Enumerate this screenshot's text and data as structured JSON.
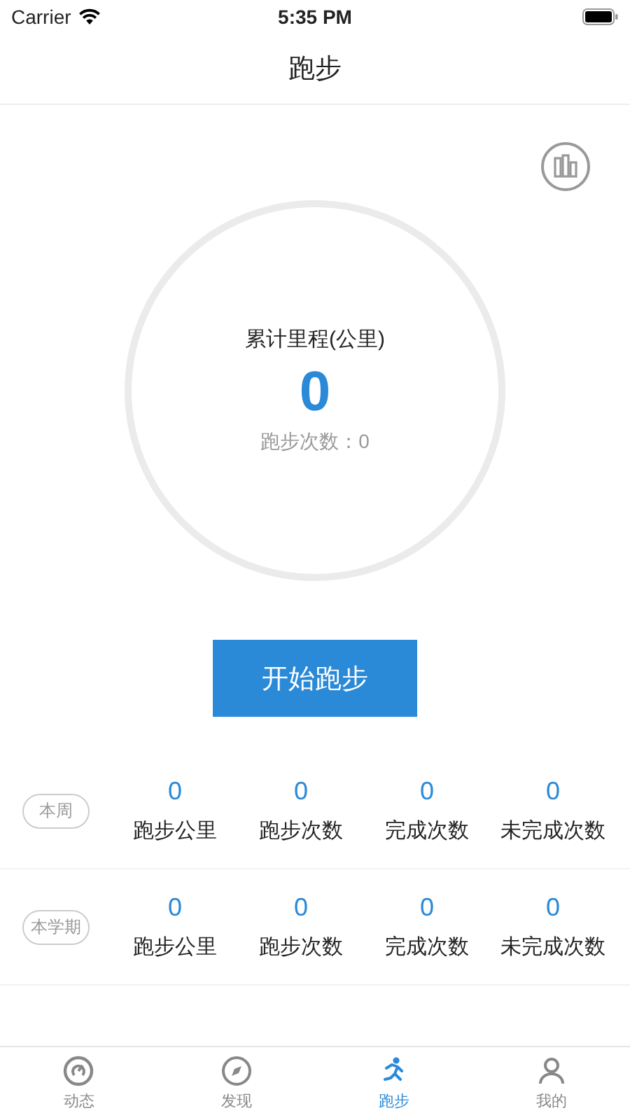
{
  "status_bar": {
    "carrier": "Carrier",
    "time": "5:35 PM"
  },
  "nav": {
    "title": "跑步"
  },
  "summary": {
    "label": "累计里程(公里)",
    "value": "0",
    "count_label": "跑步次数：0"
  },
  "start_button": "开始跑步",
  "stats": [
    {
      "period": "本周",
      "items": [
        {
          "value": "0",
          "label": "跑步公里"
        },
        {
          "value": "0",
          "label": "跑步次数"
        },
        {
          "value": "0",
          "label": "完成次数"
        },
        {
          "value": "0",
          "label": "未完成次数"
        }
      ]
    },
    {
      "period": "本学期",
      "items": [
        {
          "value": "0",
          "label": "跑步公里"
        },
        {
          "value": "0",
          "label": "跑步次数"
        },
        {
          "value": "0",
          "label": "完成次数"
        },
        {
          "value": "0",
          "label": "未完成次数"
        }
      ]
    }
  ],
  "tab_bar": [
    {
      "label": "动态",
      "kind": "gauge",
      "selected": false
    },
    {
      "label": "发现",
      "kind": "compass",
      "selected": false
    },
    {
      "label": "跑步",
      "kind": "run",
      "selected": true
    },
    {
      "label": "我的",
      "kind": "person",
      "selected": false
    }
  ]
}
